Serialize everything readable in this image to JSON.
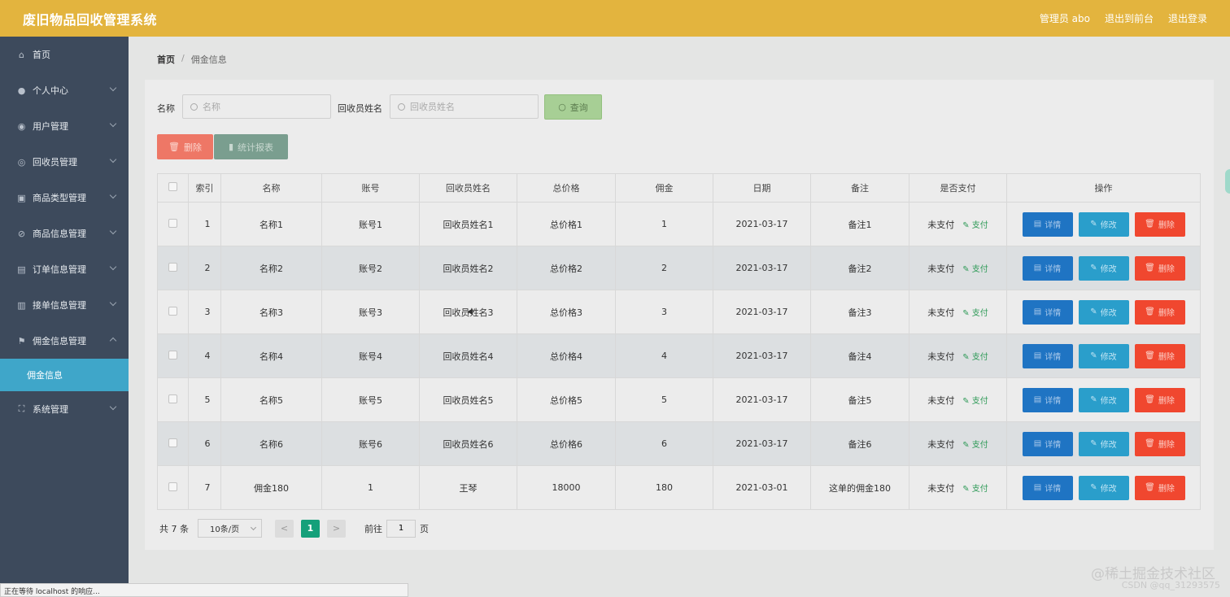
{
  "header": {
    "title": "废旧物品回收管理系统",
    "admin": "管理员 abo",
    "to_front": "退出到前台",
    "logout": "退出登录"
  },
  "sidebar": {
    "items": [
      {
        "label": "首页",
        "icon": "home-icon"
      },
      {
        "label": "个人中心",
        "icon": "user-icon"
      },
      {
        "label": "用户管理",
        "icon": "bulb-icon"
      },
      {
        "label": "回收员管理",
        "icon": "circle-icon"
      },
      {
        "label": "商品类型管理",
        "icon": "picture-icon"
      },
      {
        "label": "商品信息管理",
        "icon": "compass-icon"
      },
      {
        "label": "订单信息管理",
        "icon": "list-icon"
      },
      {
        "label": "接单信息管理",
        "icon": "printer-icon"
      },
      {
        "label": "佣金信息管理",
        "icon": "flag-icon"
      },
      {
        "label": "系统管理",
        "icon": "fullscreen-icon"
      }
    ],
    "active_sub": "佣金信息"
  },
  "breadcrumb": {
    "home": "首页",
    "sep": "/",
    "current": "佣金信息"
  },
  "search": {
    "name_label": "名称",
    "name_placeholder": "名称",
    "collector_label": "回收员姓名",
    "collector_placeholder": "回收员姓名",
    "query_button": "查询"
  },
  "actions": {
    "delete": "删除",
    "stats": "统计报表"
  },
  "table": {
    "headers": [
      "索引",
      "名称",
      "账号",
      "回收员姓名",
      "总价格",
      "佣金",
      "日期",
      "备注",
      "是否支付",
      "操作"
    ],
    "rows": [
      {
        "idx": "1",
        "name": "名称1",
        "account": "账号1",
        "collector": "回收员姓名1",
        "total": "总价格1",
        "commission": "1",
        "date": "2021-03-17",
        "note": "备注1",
        "paid": "未支付"
      },
      {
        "idx": "2",
        "name": "名称2",
        "account": "账号2",
        "collector": "回收员姓名2",
        "total": "总价格2",
        "commission": "2",
        "date": "2021-03-17",
        "note": "备注2",
        "paid": "未支付"
      },
      {
        "idx": "3",
        "name": "名称3",
        "account": "账号3",
        "collector": "回收员姓名3",
        "total": "总价格3",
        "commission": "3",
        "date": "2021-03-17",
        "note": "备注3",
        "paid": "未支付"
      },
      {
        "idx": "4",
        "name": "名称4",
        "account": "账号4",
        "collector": "回收员姓名4",
        "total": "总价格4",
        "commission": "4",
        "date": "2021-03-17",
        "note": "备注4",
        "paid": "未支付"
      },
      {
        "idx": "5",
        "name": "名称5",
        "account": "账号5",
        "collector": "回收员姓名5",
        "total": "总价格5",
        "commission": "5",
        "date": "2021-03-17",
        "note": "备注5",
        "paid": "未支付"
      },
      {
        "idx": "6",
        "name": "名称6",
        "account": "账号6",
        "collector": "回收员姓名6",
        "total": "总价格6",
        "commission": "6",
        "date": "2021-03-17",
        "note": "备注6",
        "paid": "未支付"
      },
      {
        "idx": "7",
        "name": "佣金180",
        "account": "1",
        "collector": "王琴",
        "total": "18000",
        "commission": "180",
        "date": "2021-03-01",
        "note": "这单的佣金180",
        "paid": "未支付"
      }
    ],
    "pay_link": "支付",
    "op_detail": "详情",
    "op_edit": "修改",
    "op_delete": "删除"
  },
  "pagination": {
    "total": "共 7 条",
    "page_size": "10条/页",
    "prev": "<",
    "current": "1",
    "next": ">",
    "goto_label": "前往",
    "goto_value": "1",
    "page_unit": "页"
  },
  "status_bar": "正在等待 localhost 的响应...",
  "watermark": {
    "line1": "@稀土掘金技术社区",
    "line2": "CSDN @qq_31293575"
  }
}
